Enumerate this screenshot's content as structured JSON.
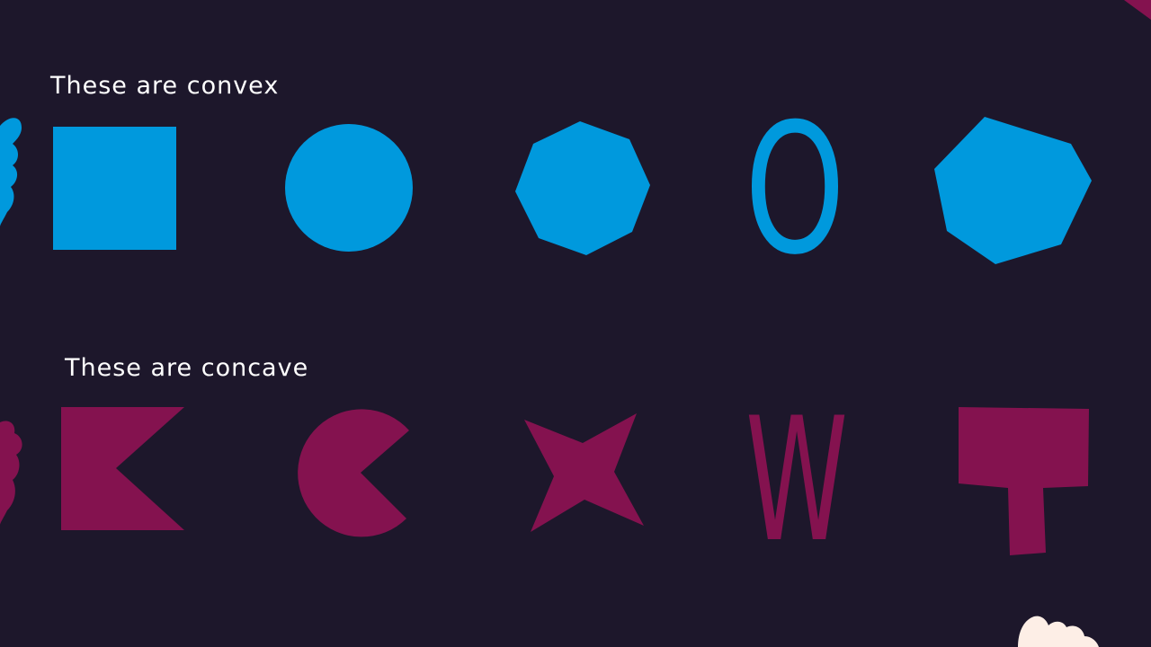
{
  "headings": {
    "convex": "These are convex",
    "concave": "These are concave"
  },
  "colors": {
    "background": "#1d172b",
    "convex_fill": "#0099dd",
    "concave_fill": "#84124f",
    "text": "#ffffff",
    "hand": "#fdeee6"
  },
  "convex_shapes": {
    "square": "square-shape",
    "circle": "circle-shape",
    "octagon": "octagon-shape",
    "letter": "O",
    "heptagon": "heptagon-shape"
  },
  "concave_shapes": {
    "arrow": "notched-square-shape",
    "pacman": "pacman-shape",
    "star": "four-point-star-shape",
    "letter": "W",
    "t_shape": "t-shape"
  },
  "decorations": [
    "decorative-blob-icon",
    "hand-icon"
  ]
}
